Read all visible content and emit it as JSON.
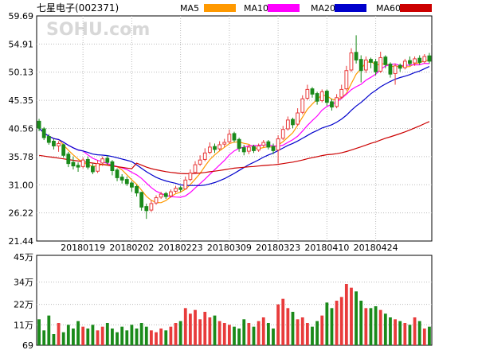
{
  "chart_data": {
    "type": "candlestick",
    "title": "七星电子(002371)",
    "watermark": "SOHU.com",
    "legend": [
      {
        "name": "MA5",
        "color": "#ff9900"
      },
      {
        "name": "MA10",
        "color": "#ff00ff"
      },
      {
        "name": "MA20",
        "color": "#0000cc"
      },
      {
        "name": "MA60",
        "color": "#cc0000"
      }
    ],
    "up_color": "#e83b3b",
    "down_color": "#1a8a1a",
    "price_axis": {
      "ticks": [
        "59.69",
        "54.91",
        "50.13",
        "45.35",
        "40.56",
        "35.78",
        "31.00",
        "26.22",
        "21.44"
      ],
      "min": 21.44,
      "max": 59.69
    },
    "date_labels": [
      {
        "label": "20180119",
        "index": 9
      },
      {
        "label": "20180202",
        "index": 19
      },
      {
        "label": "20180223",
        "index": 29
      },
      {
        "label": "20180309",
        "index": 39
      },
      {
        "label": "20180323",
        "index": 49
      },
      {
        "label": "20180410",
        "index": 59
      },
      {
        "label": "20180424",
        "index": 69
      }
    ],
    "volume_axis": {
      "ticks": [
        "45万",
        "34万",
        "22万",
        "11万",
        "69"
      ],
      "values": [
        45,
        34,
        22,
        11,
        0
      ],
      "max": 45
    },
    "candles": [
      [
        41.8,
        40.6,
        42.2,
        40.1
      ],
      [
        40.5,
        39.0,
        40.8,
        38.6
      ],
      [
        39.2,
        38.2,
        39.6,
        37.8
      ],
      [
        38.4,
        37.6,
        38.8,
        37.0
      ],
      [
        37.6,
        38.0,
        38.4,
        36.6
      ],
      [
        37.8,
        36.0,
        38.0,
        35.6
      ],
      [
        36.2,
        34.6,
        36.6,
        34.0
      ],
      [
        34.8,
        34.2,
        35.8,
        33.6
      ],
      [
        34.3,
        34.0,
        34.8,
        33.2
      ],
      [
        34.1,
        35.2,
        35.6,
        33.8
      ],
      [
        35.3,
        34.0,
        35.8,
        33.6
      ],
      [
        34.1,
        33.2,
        34.6,
        32.8
      ],
      [
        33.3,
        34.6,
        35.2,
        33.0
      ],
      [
        34.7,
        35.4,
        35.8,
        34.2
      ],
      [
        35.5,
        34.8,
        36.0,
        34.4
      ],
      [
        34.9,
        33.4,
        35.2,
        32.6
      ],
      [
        33.5,
        32.2,
        33.8,
        31.6
      ],
      [
        32.3,
        31.8,
        32.8,
        31.2
      ],
      [
        31.9,
        31.2,
        32.4,
        30.8
      ],
      [
        31.3,
        30.6,
        31.6,
        29.8
      ],
      [
        30.7,
        29.6,
        31.0,
        29.0
      ],
      [
        29.7,
        27.2,
        29.8,
        26.6
      ],
      [
        27.3,
        26.6,
        27.8,
        25.2
      ],
      [
        26.7,
        27.8,
        28.4,
        26.4
      ],
      [
        27.9,
        28.8,
        29.2,
        27.6
      ],
      [
        28.9,
        29.4,
        29.8,
        28.6
      ],
      [
        29.5,
        29.0,
        29.8,
        28.6
      ],
      [
        29.1,
        29.8,
        30.2,
        28.8
      ],
      [
        29.9,
        30.4,
        30.8,
        29.6
      ],
      [
        30.5,
        30.2,
        30.8,
        29.8
      ],
      [
        30.3,
        31.8,
        32.4,
        30.2
      ],
      [
        31.9,
        33.0,
        33.6,
        31.6
      ],
      [
        33.1,
        34.4,
        35.0,
        32.8
      ],
      [
        34.5,
        35.2,
        36.0,
        34.2
      ],
      [
        35.3,
        36.4,
        37.2,
        35.0
      ],
      [
        36.5,
        37.4,
        38.2,
        36.2
      ],
      [
        37.5,
        37.0,
        38.0,
        36.4
      ],
      [
        37.1,
        37.8,
        38.4,
        36.8
      ],
      [
        37.9,
        38.2,
        38.8,
        37.4
      ],
      [
        38.3,
        39.6,
        40.4,
        38.0
      ],
      [
        39.7,
        38.6,
        40.0,
        38.2
      ],
      [
        38.7,
        37.2,
        39.0,
        36.6
      ],
      [
        37.3,
        36.6,
        37.8,
        36.0
      ],
      [
        36.7,
        37.4,
        37.8,
        36.2
      ],
      [
        37.5,
        36.8,
        37.8,
        36.4
      ],
      [
        36.9,
        37.6,
        38.0,
        36.6
      ],
      [
        37.7,
        38.2,
        38.6,
        37.4
      ],
      [
        38.3,
        37.4,
        38.6,
        37.0
      ],
      [
        37.5,
        36.8,
        38.0,
        36.2
      ],
      [
        36.9,
        38.8,
        39.4,
        34.6
      ],
      [
        38.9,
        40.4,
        41.0,
        38.6
      ],
      [
        40.5,
        42.0,
        42.6,
        40.2
      ],
      [
        42.1,
        41.2,
        42.4,
        40.6
      ],
      [
        41.3,
        43.2,
        44.0,
        41.0
      ],
      [
        43.3,
        45.6,
        46.2,
        43.0
      ],
      [
        45.7,
        47.2,
        48.0,
        45.4
      ],
      [
        47.3,
        46.4,
        47.6,
        45.8
      ],
      [
        46.5,
        45.2,
        46.8,
        44.6
      ],
      [
        45.3,
        46.8,
        47.2,
        45.0
      ],
      [
        46.9,
        45.0,
        47.2,
        44.4
      ],
      [
        45.1,
        44.2,
        45.6,
        43.6
      ],
      [
        44.3,
        45.8,
        46.4,
        44.0
      ],
      [
        45.9,
        47.2,
        48.0,
        45.6
      ],
      [
        47.3,
        50.4,
        51.2,
        47.0
      ],
      [
        50.5,
        53.4,
        54.2,
        50.2
      ],
      [
        53.5,
        52.2,
        56.4,
        51.6
      ],
      [
        52.3,
        50.4,
        53.0,
        48.4
      ],
      [
        50.5,
        52.2,
        52.8,
        50.0
      ],
      [
        52.3,
        51.8,
        52.6,
        50.8
      ],
      [
        51.9,
        50.2,
        52.4,
        49.6
      ],
      [
        50.3,
        52.6,
        53.6,
        50.0
      ],
      [
        52.7,
        51.4,
        53.0,
        50.8
      ],
      [
        51.5,
        49.8,
        51.8,
        49.2
      ],
      [
        49.9,
        51.2,
        51.6,
        48.0
      ],
      [
        51.3,
        50.8,
        51.6,
        50.2
      ],
      [
        50.9,
        52.0,
        52.4,
        50.6
      ],
      [
        52.1,
        51.6,
        52.8,
        51.2
      ],
      [
        51.7,
        52.4,
        52.8,
        51.2
      ],
      [
        52.5,
        51.8,
        53.0,
        51.4
      ],
      [
        51.9,
        52.8,
        53.2,
        51.6
      ],
      [
        52.9,
        52.0,
        53.4,
        51.6
      ]
    ],
    "volumes": [
      14,
      8,
      16,
      6,
      12,
      7,
      11,
      9,
      13,
      10,
      9,
      11,
      8,
      10,
      12,
      9,
      7,
      10,
      8,
      11,
      9,
      12,
      10,
      8,
      7,
      9,
      8,
      10,
      12,
      13,
      20,
      17,
      19,
      14,
      18,
      15,
      16,
      13,
      12,
      11,
      10,
      9,
      14,
      12,
      10,
      13,
      15,
      12,
      9,
      22,
      25,
      20,
      18,
      14,
      15,
      12,
      10,
      13,
      16,
      23,
      20,
      24,
      26,
      33,
      31,
      29,
      24,
      20,
      20,
      21,
      19,
      17,
      15,
      14,
      13,
      12,
      11,
      15,
      13,
      9,
      10
    ]
  }
}
